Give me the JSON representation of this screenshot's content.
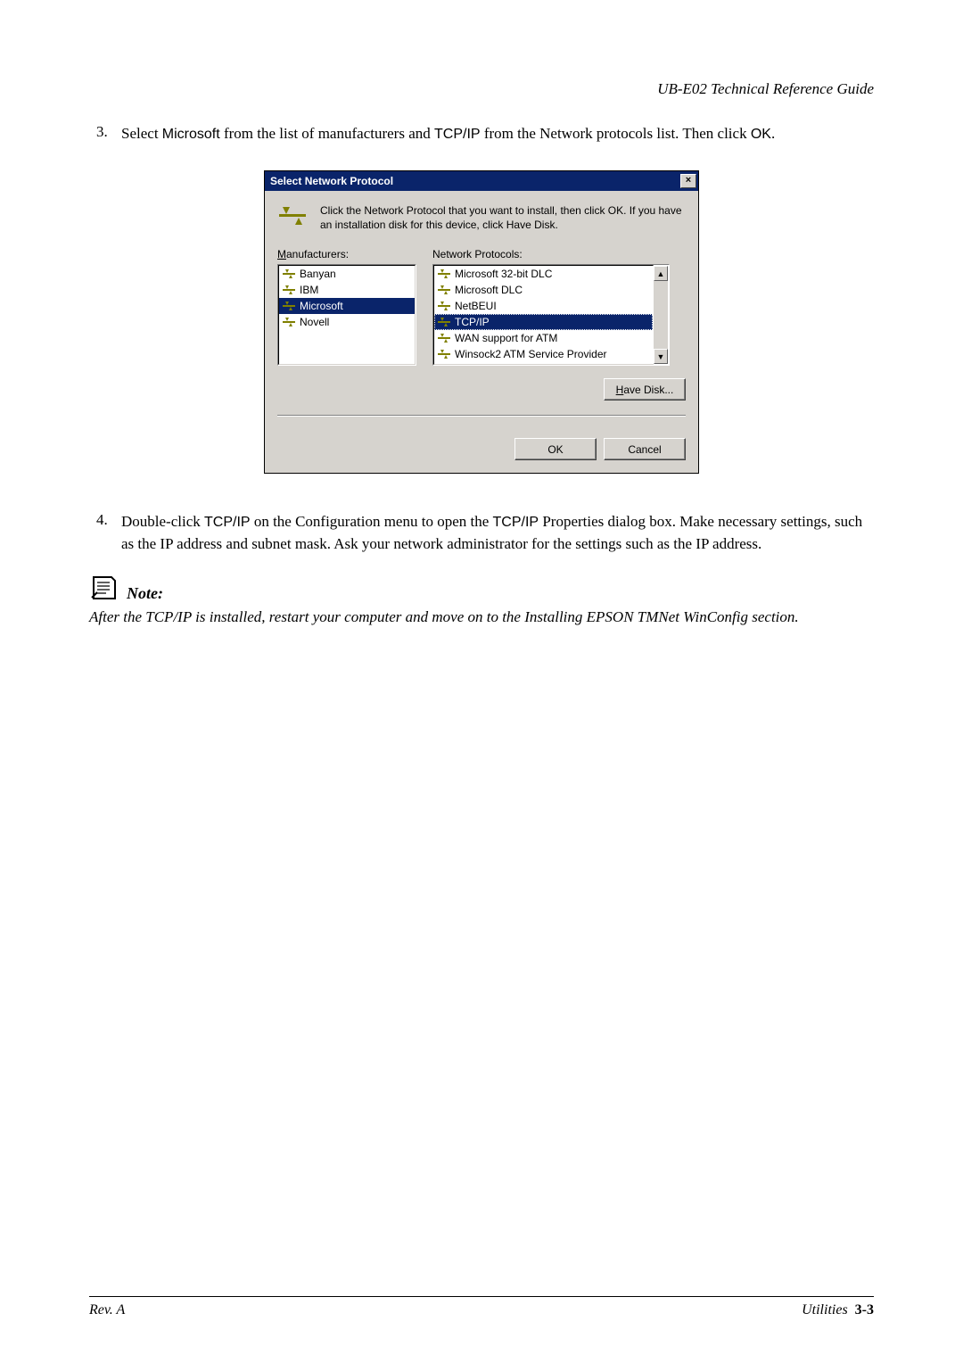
{
  "header": {
    "doc_title": "UB-E02 Technical Reference Guide"
  },
  "step3": {
    "num": "3.",
    "t1": "Select ",
    "ms": "Microsoft",
    "t2": " from the list of manufacturers and ",
    "tcp": "TCP/IP",
    "t3": " from the Network protocols list. Then click ",
    "ok": "OK",
    "t4": "."
  },
  "dialog": {
    "title": "Select Network Protocol",
    "close": "×",
    "desc": "Click the Network Protocol that you want to install, then click OK. If you have an installation disk for this device, click Have Disk.",
    "manu_label_pre": "M",
    "manu_label_rest": "anufacturers:",
    "proto_label": "Network Protocols:",
    "manufacturers": [
      {
        "name": "Banyan",
        "sel": false
      },
      {
        "name": "IBM",
        "sel": false
      },
      {
        "name": "Microsoft",
        "sel": true
      },
      {
        "name": "Novell",
        "sel": false
      }
    ],
    "protocols": [
      {
        "name": "Microsoft 32-bit DLC",
        "sel": false
      },
      {
        "name": "Microsoft DLC",
        "sel": false
      },
      {
        "name": "NetBEUI",
        "sel": false
      },
      {
        "name": "TCP/IP",
        "sel": true
      },
      {
        "name": "WAN support for ATM",
        "sel": false
      },
      {
        "name": "Winsock2 ATM Service Provider",
        "sel": false
      }
    ],
    "have_disk_pre": "H",
    "have_disk_rest": "ave Disk...",
    "ok": "OK",
    "cancel": "Cancel",
    "scroll_up": "▲",
    "scroll_down": "▼"
  },
  "step4": {
    "num": "4.",
    "t1": "Double-click ",
    "tcp1": "TCP/IP",
    "t2": " on the Configuration menu to open the ",
    "tcp2": "TCP/IP",
    "t3": " Properties dialog box. Make necessary settings, such as the IP address and subnet mask. Ask your network administrator for the settings such as the IP address."
  },
  "note": {
    "label": "Note:",
    "body": "After the TCP/IP is installed, restart your computer and move on to the Installing EPSON TMNet WinConfig section."
  },
  "footer": {
    "left": "Rev. A",
    "right_label": "Utilities",
    "right_page": "3-3"
  }
}
